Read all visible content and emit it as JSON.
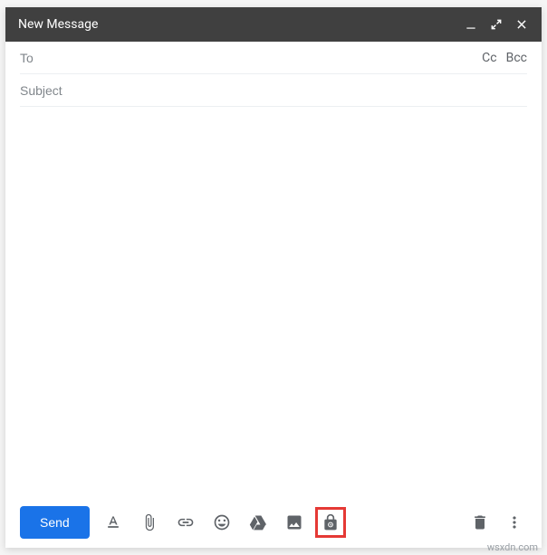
{
  "header": {
    "title": "New Message"
  },
  "fields": {
    "to_placeholder": "To",
    "subject_placeholder": "Subject",
    "cc_label": "Cc",
    "bcc_label": "Bcc"
  },
  "toolbar": {
    "send_label": "Send"
  },
  "watermark": "wsxdn.com"
}
